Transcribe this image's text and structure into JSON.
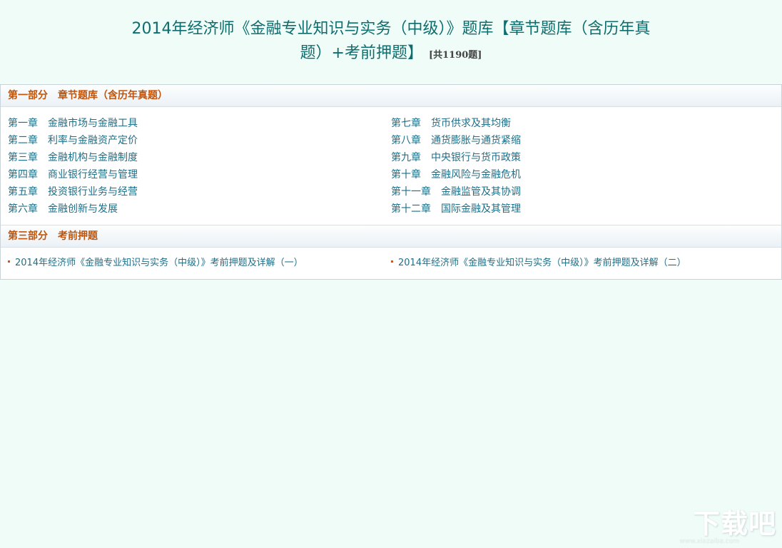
{
  "title": {
    "line1": "2014年经济师《金融专业知识与实务（中级）》题库【章节题库（含历年真",
    "line2": "题）+考前押题】",
    "count": "[共1190题]"
  },
  "part1": {
    "heading": "第一部分　章节题库（含历年真题）",
    "left": [
      "第一章　金融市场与金融工具",
      "第二章　利率与金融资产定价",
      "第三章　金融机构与金融制度",
      "第四章　商业银行经营与管理",
      "第五章　投资银行业务与经营",
      "第六章　金融创新与发展"
    ],
    "right": [
      "第七章　货币供求及其均衡",
      "第八章　通货膨胀与通货紧缩",
      "第九章　中央银行与货币政策",
      "第十章　金融风险与金融危机",
      "第十一章　金融监管及其协调",
      "第十二章　国际金融及其管理"
    ]
  },
  "part3": {
    "heading": "第三部分　考前押题",
    "items": [
      "2014年经济师《金融专业知识与实务（中级）》考前押题及详解（一）",
      "2014年经济师《金融专业知识与实务（中级）》考前押题及详解（二）"
    ]
  },
  "watermark": {
    "text": "下载吧",
    "sub": "www.xiazaiba.com"
  }
}
